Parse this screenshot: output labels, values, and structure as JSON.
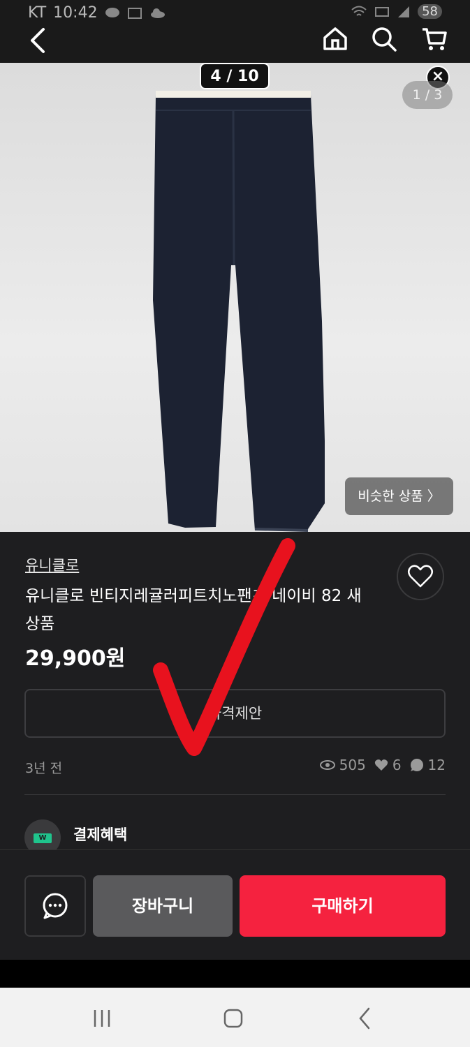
{
  "status_bar": {
    "carrier": "KT",
    "time": "10:42",
    "battery": "58"
  },
  "image_viewer": {
    "counter": "4 / 10",
    "close_label": "×",
    "image_index": "1 / 3",
    "similar_label": "비슷한 상품  〉"
  },
  "product": {
    "brand": "유니클로",
    "title": "유니클로 빈티지레귤러피트치노팬츠 네이비 82 새상품",
    "price": "29,900원",
    "offer_label": "가격제안",
    "time_ago": "3년 전",
    "views": "505",
    "likes": "6",
    "chats": "12",
    "benefit_label": "결제혜택",
    "benefit_icon_text": "W"
  },
  "actions": {
    "cart_label": "장바구니",
    "buy_label": "구매하기"
  },
  "colors": {
    "accent": "#f5223f",
    "background": "#1e1e20",
    "annotation": "#e8121e"
  }
}
